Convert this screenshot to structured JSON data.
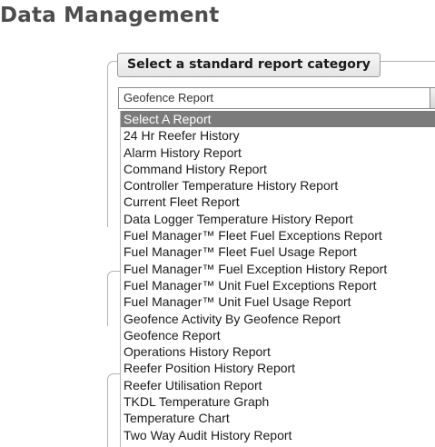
{
  "page": {
    "title": "Data Management"
  },
  "report_category": {
    "legend": "Select a standard report category",
    "selected_value": "Geofence Report",
    "dropdown": {
      "highlighted_index": 0,
      "options": [
        "Select A Report",
        "24 Hr Reefer History",
        "Alarm History Report",
        "Command History Report",
        "Controller Temperature History Report",
        "Current Fleet Report",
        "Data Logger Temperature History Report",
        "Fuel Manager™ Fleet Fuel Exceptions Report",
        "Fuel Manager™ Fleet Fuel Usage Report",
        "Fuel Manager™ Fuel Exception History Report",
        "Fuel Manager™ Unit Fuel Exceptions Report",
        "Fuel Manager™ Unit Fuel Usage Report",
        "Geofence Activity By Geofence Report",
        "Geofence Report",
        "Operations History Report",
        "Reefer Position History Report",
        "Reefer Utilisation Report",
        "TKDL Temperature Graph",
        "Temperature Chart",
        "Two Way Audit History Report"
      ]
    }
  },
  "colors": {
    "title_text": "#4d4d4d",
    "highlight_background": "#7b7b7b",
    "highlight_text": "#ffffff",
    "border": "#b3b3b3"
  }
}
